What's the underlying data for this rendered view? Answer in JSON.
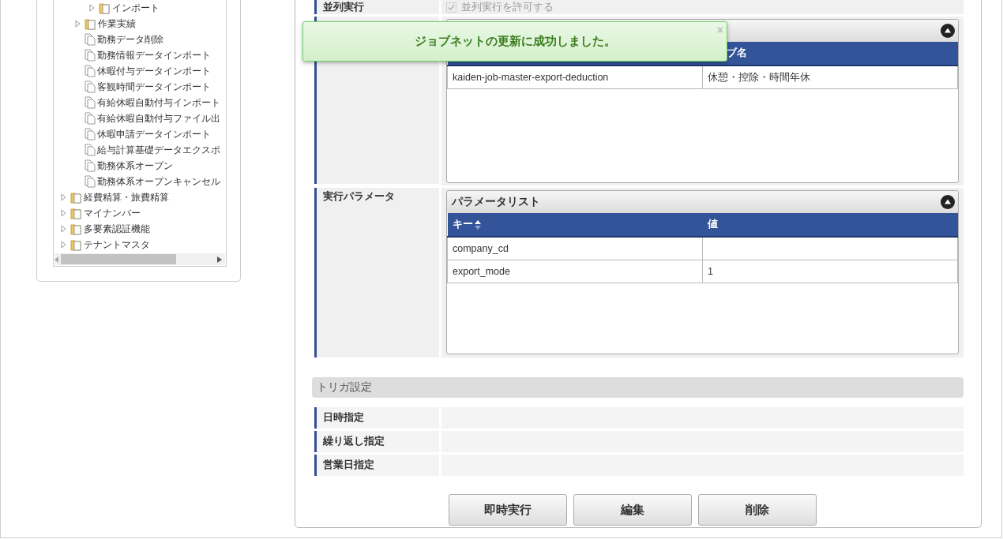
{
  "tree": [
    {
      "children": [
        {
          "children": [
            {
              "kind": "folder",
              "label": "インポート"
            }
          ]
        },
        {
          "kind": "folder",
          "label": "作業実績"
        },
        {
          "kind": "file",
          "label": "勤務データ削除"
        },
        {
          "kind": "file",
          "label": "勤務情報データインポート"
        },
        {
          "kind": "file",
          "label": "休暇付与データインポート"
        },
        {
          "kind": "file",
          "label": "客観時間データインポート"
        },
        {
          "kind": "file",
          "label": "有給休暇自動付与インポート"
        },
        {
          "kind": "file",
          "label": "有給休暇自動付与ファイル出"
        },
        {
          "kind": "file",
          "label": "休暇申請データインポート"
        },
        {
          "kind": "file",
          "label": "給与計算基礎データエクスポ"
        },
        {
          "kind": "file",
          "label": "勤務体系オープン"
        },
        {
          "kind": "file",
          "label": "勤務体系オープンキャンセル"
        }
      ]
    },
    {
      "kind": "folder",
      "label": "経費精算・旅費精算"
    },
    {
      "kind": "folder",
      "label": "マイナンバー"
    },
    {
      "kind": "folder",
      "label": "多要素認証機能"
    },
    {
      "kind": "folder",
      "label": "テナントマスタ"
    }
  ],
  "form": [
    {
      "kind": "checkbox",
      "label": "並列実行",
      "option": "並列実行を許可する",
      "checked": true,
      "disabled": true
    },
    {
      "kind": "job_table",
      "column_2": "ブ名",
      "rows": [
        {
          "column_1": "kaiden-job-master-export-deduction",
          "column_2": "休憩・控除・時間年休"
        }
      ]
    },
    {
      "kind": "param_table",
      "label": "実行パラメータ",
      "title": "パラメータリスト",
      "columns": [
        {
          "label": "キー",
          "sortable": true
        },
        {
          "label": "値",
          "sortable": false
        }
      ],
      "rows": [
        {
          "key": "company_cd"
        },
        {
          "key": "export_mode",
          "value": "1"
        }
      ]
    }
  ],
  "trigger": {
    "title": "トリガ設定",
    "rows": [
      "日時指定",
      "繰り返し指定",
      "営業日指定"
    ]
  },
  "buttons": [
    "即時実行",
    "編集",
    "削除"
  ],
  "toast": {
    "message": "ジョブネットの更新に成功しました。",
    "close": "×"
  }
}
